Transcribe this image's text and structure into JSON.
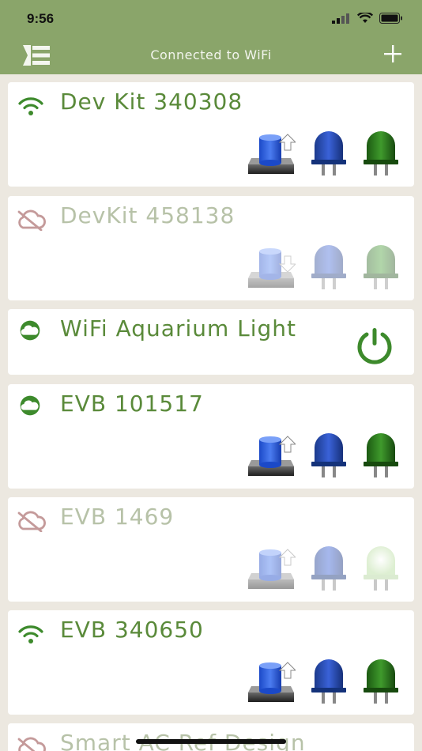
{
  "status_bar": {
    "time": "9:56"
  },
  "header": {
    "title": "Connected to WiFi",
    "menu_icon": "menu-icon",
    "add_icon": "plus-icon"
  },
  "devices": [
    {
      "name": "Dev Kit 340308",
      "connection": "wifi",
      "state": "active",
      "type": "devkit"
    },
    {
      "name": "DevKit 458138",
      "connection": "offline",
      "state": "dim",
      "type": "devkit"
    },
    {
      "name": "WiFi Aquarium Light",
      "connection": "cloud",
      "state": "active",
      "type": "power"
    },
    {
      "name": "EVB 101517",
      "connection": "cloud",
      "state": "active",
      "type": "devkit"
    },
    {
      "name": "EVB 1469",
      "connection": "offline",
      "state": "dim",
      "type": "devkit"
    },
    {
      "name": "EVB 340650",
      "connection": "wifi",
      "state": "active",
      "type": "devkit"
    },
    {
      "name": "Smart AC Ref Design",
      "connection": "offline",
      "state": "dim",
      "type": "devkit"
    }
  ],
  "colors": {
    "header_bg": "#8aa56a",
    "accent": "#5a8a3a",
    "background": "#ece8e0",
    "offline_icon": "#c49a9a"
  }
}
